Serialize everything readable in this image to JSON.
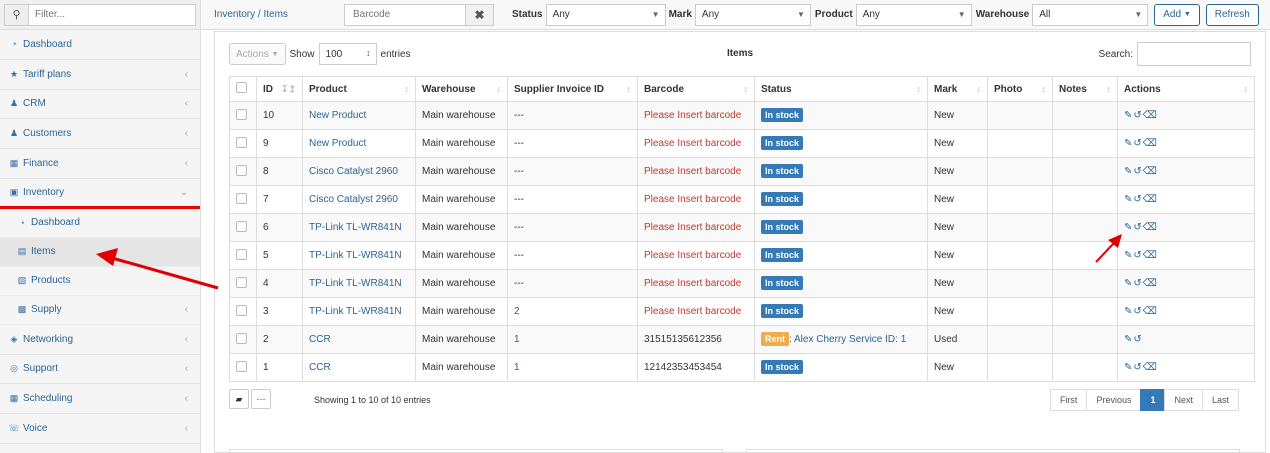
{
  "sidebar": {
    "filter_placeholder": "Filter...",
    "items": [
      {
        "label": "Dashboard",
        "icon": "tachometer-icon",
        "chevron": false
      },
      {
        "label": "Tariff plans",
        "icon": "star-icon",
        "chevron": true
      },
      {
        "label": "CRM",
        "icon": "users-icon",
        "chevron": true
      },
      {
        "label": "Customers",
        "icon": "user-icon",
        "chevron": true
      },
      {
        "label": "Finance",
        "icon": "calculator-icon",
        "chevron": true
      },
      {
        "label": "Inventory",
        "icon": "folder-icon",
        "chevron": "down"
      }
    ],
    "sub_items": [
      {
        "label": "Dashboard",
        "icon": "tachometer-icon"
      },
      {
        "label": "Items",
        "icon": "inbox-icon"
      },
      {
        "label": "Products",
        "icon": "barcode-icon"
      },
      {
        "label": "Supply",
        "icon": "truck-icon"
      }
    ],
    "items_after": [
      {
        "label": "Networking",
        "icon": "sitemap-icon"
      },
      {
        "label": "Support",
        "icon": "life-ring-icon"
      },
      {
        "label": "Scheduling",
        "icon": "calendar-icon"
      },
      {
        "label": "Voice",
        "icon": "phone-icon"
      }
    ]
  },
  "topbar": {
    "breadcrumb": "Inventory / Items",
    "barcode_placeholder": "Barcode",
    "filters": [
      {
        "label": "Status",
        "value": "Any"
      },
      {
        "label": "Mark",
        "value": "Any"
      },
      {
        "label": "Product",
        "value": "Any"
      },
      {
        "label": "Warehouse",
        "value": "All"
      }
    ],
    "add_label": "Add",
    "refresh_label": "Refresh"
  },
  "table": {
    "actions_label": "Actions",
    "show_label": "Show",
    "length_value": "100",
    "entries_label": "entries",
    "title": "Items",
    "search_label": "Search:",
    "columns": [
      "ID",
      "Product",
      "Warehouse",
      "Supplier Invoice ID",
      "Barcode",
      "Status",
      "Mark",
      "Photo",
      "Notes",
      "Actions"
    ],
    "rows": [
      {
        "id": "10",
        "product": "New Product",
        "warehouse": "Main warehouse",
        "invoice": "---",
        "barcode": "Please Insert barcode",
        "status": "In stock",
        "mark": "New"
      },
      {
        "id": "9",
        "product": "New Product",
        "warehouse": "Main warehouse",
        "invoice": "---",
        "barcode": "Please Insert barcode",
        "status": "In stock",
        "mark": "New"
      },
      {
        "id": "8",
        "product": "Cisco Catalyst 2960",
        "warehouse": "Main warehouse",
        "invoice": "---",
        "barcode": "Please Insert barcode",
        "status": "In stock",
        "mark": "New"
      },
      {
        "id": "7",
        "product": "Cisco Catalyst 2960",
        "warehouse": "Main warehouse",
        "invoice": "---",
        "barcode": "Please Insert barcode",
        "status": "In stock",
        "mark": "New"
      },
      {
        "id": "6",
        "product": "TP-Link TL-WR841N",
        "warehouse": "Main warehouse",
        "invoice": "---",
        "barcode": "Please Insert barcode",
        "status": "In stock",
        "mark": "New"
      },
      {
        "id": "5",
        "product": "TP-Link TL-WR841N",
        "warehouse": "Main warehouse",
        "invoice": "---",
        "barcode": "Please Insert barcode",
        "status": "In stock",
        "mark": "New"
      },
      {
        "id": "4",
        "product": "TP-Link TL-WR841N",
        "warehouse": "Main warehouse",
        "invoice": "---",
        "barcode": "Please Insert barcode",
        "status": "In stock",
        "mark": "New"
      },
      {
        "id": "3",
        "product": "TP-Link TL-WR841N",
        "warehouse": "Main warehouse",
        "invoice": "2",
        "barcode": "Please Insert barcode",
        "status": "In stock",
        "mark": "New"
      },
      {
        "id": "2",
        "product": "CCR",
        "warehouse": "Main warehouse",
        "invoice": "1",
        "barcode": "31515135612356",
        "status": "Rent",
        "status_extra": ": Alex Cherry Service ID: 1",
        "mark": "Used"
      },
      {
        "id": "1",
        "product": "CCR",
        "warehouse": "Main warehouse",
        "invoice": "1",
        "barcode": "12142353453454",
        "status": "In stock",
        "mark": "New"
      }
    ],
    "info": "Showing 1 to 10 of 10 entries",
    "pager": [
      "First",
      "Previous",
      "1",
      "Next",
      "Last"
    ]
  },
  "colors": {
    "link": "#2a6496",
    "primary": "#337ab7",
    "rent": "#f0ad4e",
    "annotation": "#e00000"
  }
}
